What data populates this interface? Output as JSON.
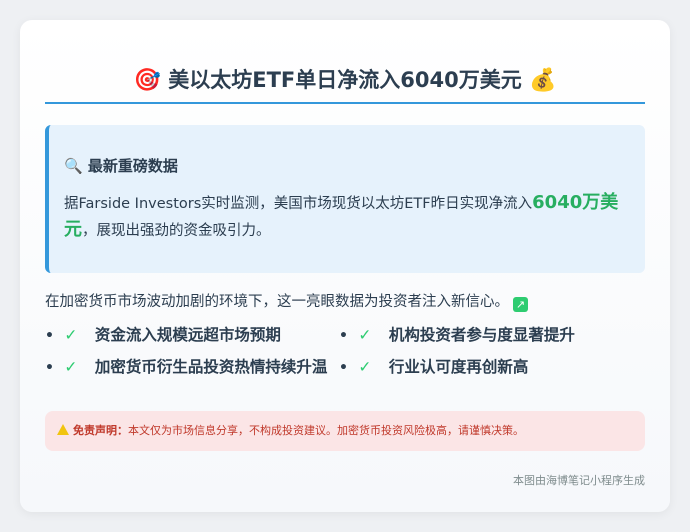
{
  "header": {
    "icon_left": "target-icon",
    "icon_right": "money-bag-icon",
    "emoji_left": "🎯",
    "emoji_right": "💰",
    "title": "美以太坊ETF单日净流入6040万美元"
  },
  "highlight": {
    "icon": "magnifier-icon",
    "emoji": "🔍",
    "heading": "最新重磅数据",
    "body_before": "据Farside Investors实时监测，美国市场现货以太坊ETF昨日实现净流入",
    "amount": "6040万美元",
    "body_after": "，展现出强劲的资金吸引力。"
  },
  "intro": {
    "text": "在加密货币市场波动加剧的环境下，这一亮眼数据为投资者注入新信心。",
    "icon": "chart-up-icon"
  },
  "features": [
    "资金流入规模远超市场预期",
    "机构投资者参与度显著提升",
    "加密货币衍生品投资热情持续升温",
    "行业认可度再创新高"
  ],
  "disclaimer": {
    "icon": "warning-icon",
    "label": "免责声明：",
    "text": "本文仅为市场信息分享，不构成投资建议。加密货币投资风险极高，请谨慎决策。"
  },
  "footer": {
    "text": "本图由海博笔记小程序生成"
  },
  "colors": {
    "accent": "#3498db",
    "positive": "#27ae60",
    "danger": "#c0392b",
    "disclaimer_bg": "#fbe5e6",
    "highlight_bg": "#e6f2fc"
  }
}
